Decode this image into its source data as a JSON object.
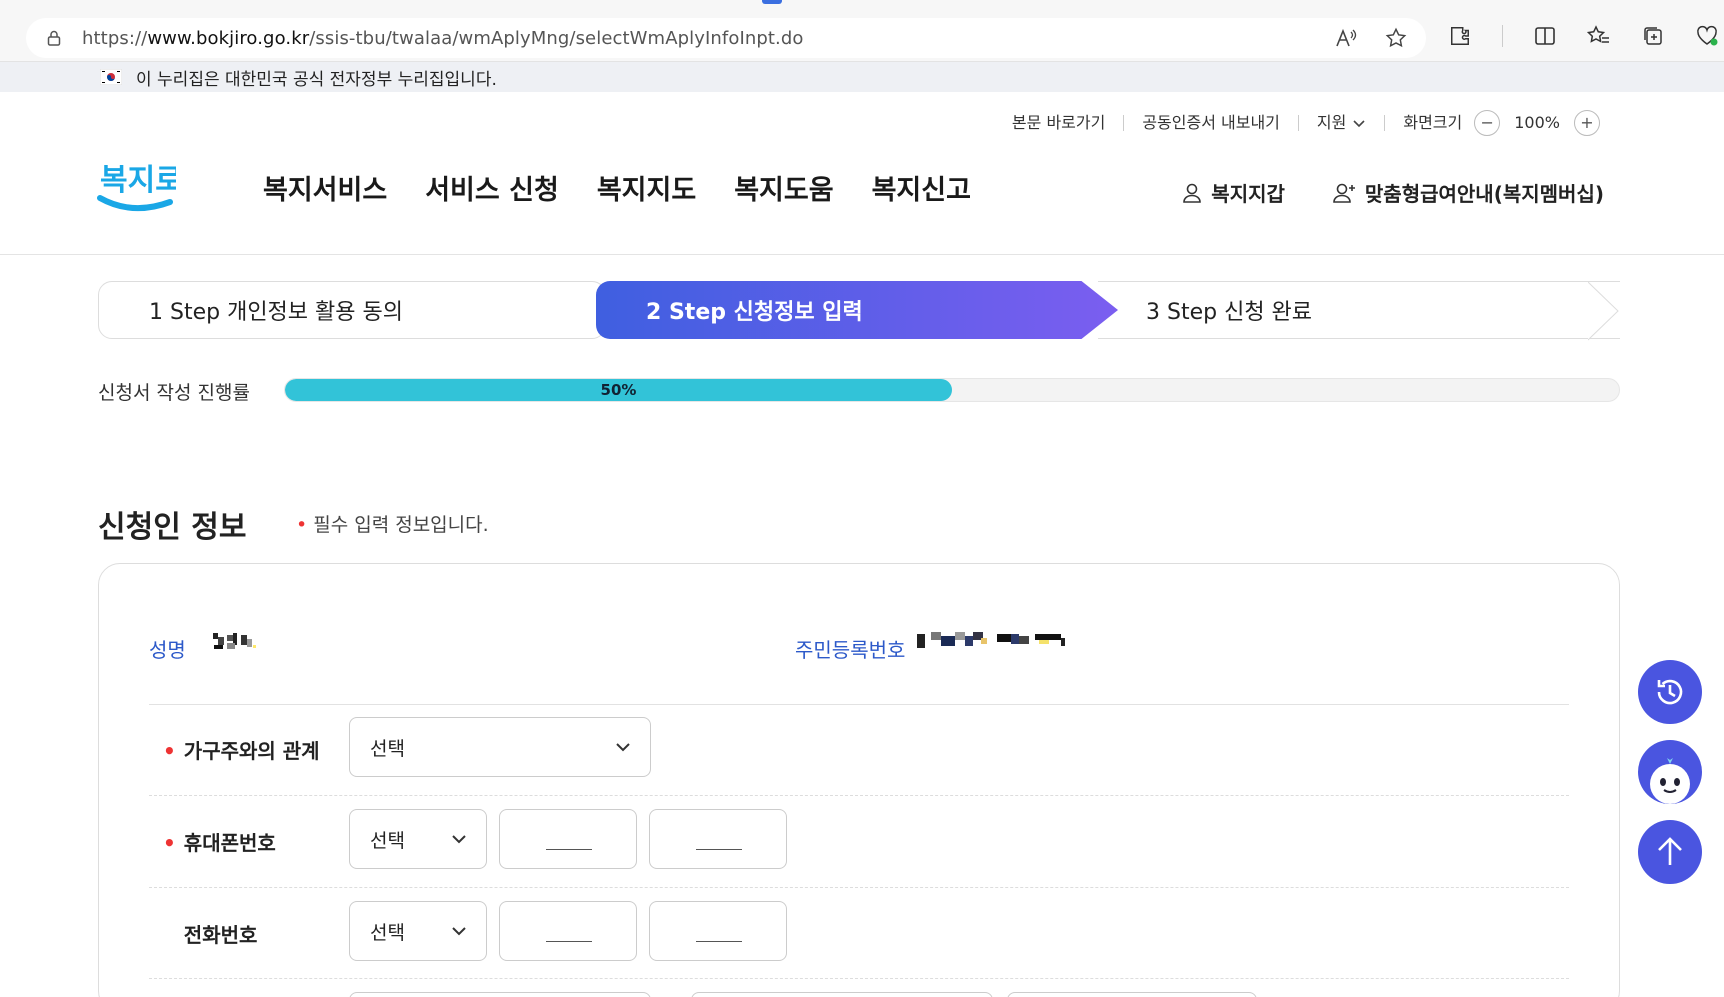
{
  "browser": {
    "url_scheme": "https://",
    "url_host": "www.bokjiro.go.kr",
    "url_path": "/ssis-tbu/twalaa/wmAplyMng/selectWmAplyInfoInpt.do"
  },
  "gov_banner": {
    "text": "이 누리집은 대한민국 공식 전자정부 누리집입니다."
  },
  "utility": {
    "skip": "본문 바로가기",
    "cert": "공동인증서 내보내기",
    "support": "지원",
    "screen_size": "화면크기",
    "zoom": "100%",
    "zoom_out": "−",
    "zoom_in": "+"
  },
  "logo": {
    "text": "복지로",
    "color": "#1aa7e6"
  },
  "nav": {
    "items": [
      "복지서비스",
      "서비스 신청",
      "복지지도",
      "복지도움",
      "복지신고"
    ]
  },
  "header_right": {
    "wallet": "복지지갑",
    "membership": "맞춤형급여안내(복지멤버십)"
  },
  "steps": [
    {
      "label": "1 Step 개인정보 활용 동의"
    },
    {
      "label": "2 Step 신청정보 입력"
    },
    {
      "label": "3 Step 신청 완료"
    }
  ],
  "progress": {
    "label": "신청서 작성 진행률",
    "percent": 50,
    "text": "50%",
    "color": "#32c3d8"
  },
  "section": {
    "title": "신청인 정보",
    "required_note": "필수 입력 정보입니다."
  },
  "applicant": {
    "name_label": "성명",
    "rrn_label": "주민등록번호"
  },
  "form": {
    "relation_label": "가구주와의 관계",
    "relation_value": "선택",
    "mobile_label": "휴대폰번호",
    "mobile_prefix": "선택",
    "phone_label": "전화번호",
    "phone_prefix": "선택"
  },
  "colors": {
    "accent_blue": "#2c59c9",
    "step_gradient_start": "#3f5fe0",
    "step_gradient_end": "#7b5ef0",
    "required_red": "#e33333",
    "float_button": "#4a55e0"
  }
}
